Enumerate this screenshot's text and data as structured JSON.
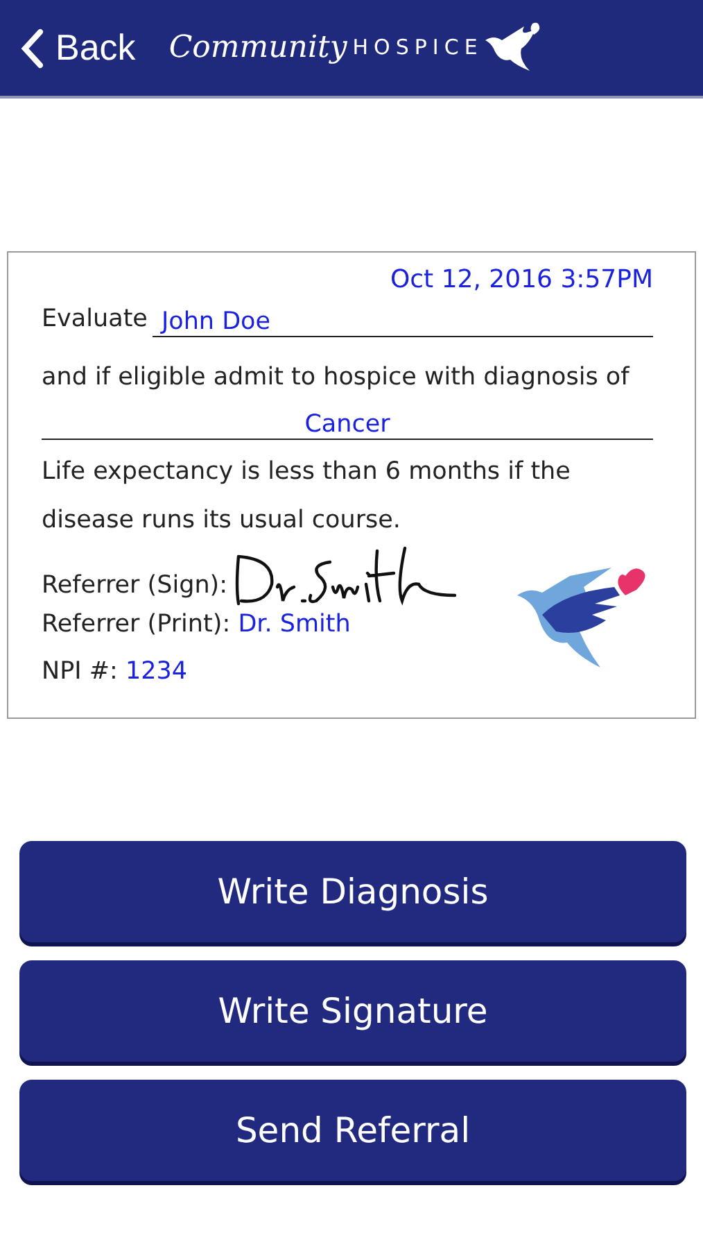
{
  "nav": {
    "back": "Back",
    "logo_script": "Community",
    "logo_caps": "HOSPICE"
  },
  "form": {
    "timestamp": "Oct 12, 2016 3:57PM",
    "evaluate_label": "Evaluate",
    "patient": "John Doe",
    "eligibility_text": "and if eligible admit to hospice with diagnosis of",
    "diagnosis": "Cancer",
    "prognosis_text": "Life expectancy is less than 6 months if the disease runs its usual course.",
    "sign_label": "Referrer (Sign):",
    "print_label": "Referrer (Print):",
    "printed_name": "Dr. Smith",
    "npi_label": "NPI #:",
    "npi": "1234"
  },
  "buttons": [
    "Write Diagnosis",
    "Write Signature",
    "Send Referral"
  ]
}
